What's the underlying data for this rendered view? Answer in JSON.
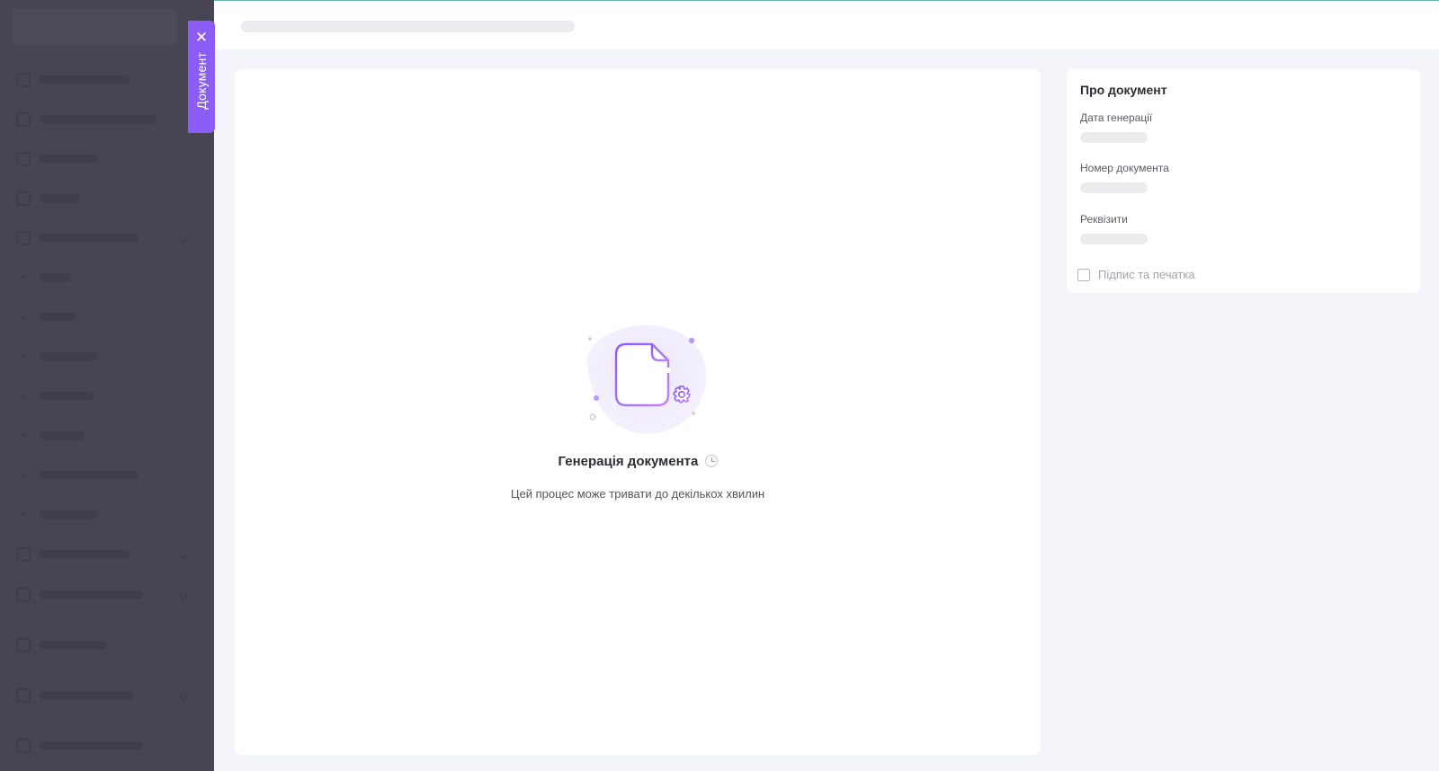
{
  "doc_tab": {
    "label": "Документ",
    "close_glyph": "✕"
  },
  "main": {
    "title": "Генерація документа",
    "subtitle": "Цей процес може тривати до декількох хвилин",
    "illustration_icon": "document-gear-icon",
    "status_icon": "clock-icon"
  },
  "about": {
    "title": "Про документ",
    "fields": [
      {
        "label": "Дата генерації"
      },
      {
        "label": "Номер документа"
      },
      {
        "label": "Реквізити"
      }
    ],
    "checkbox": {
      "label": "Підпис та печатка",
      "checked": false
    }
  },
  "colors": {
    "accent": "#8b5cf6",
    "sidebar_overlay": "#474553",
    "skeleton": "#ececef",
    "background": "#f4f5fa"
  }
}
